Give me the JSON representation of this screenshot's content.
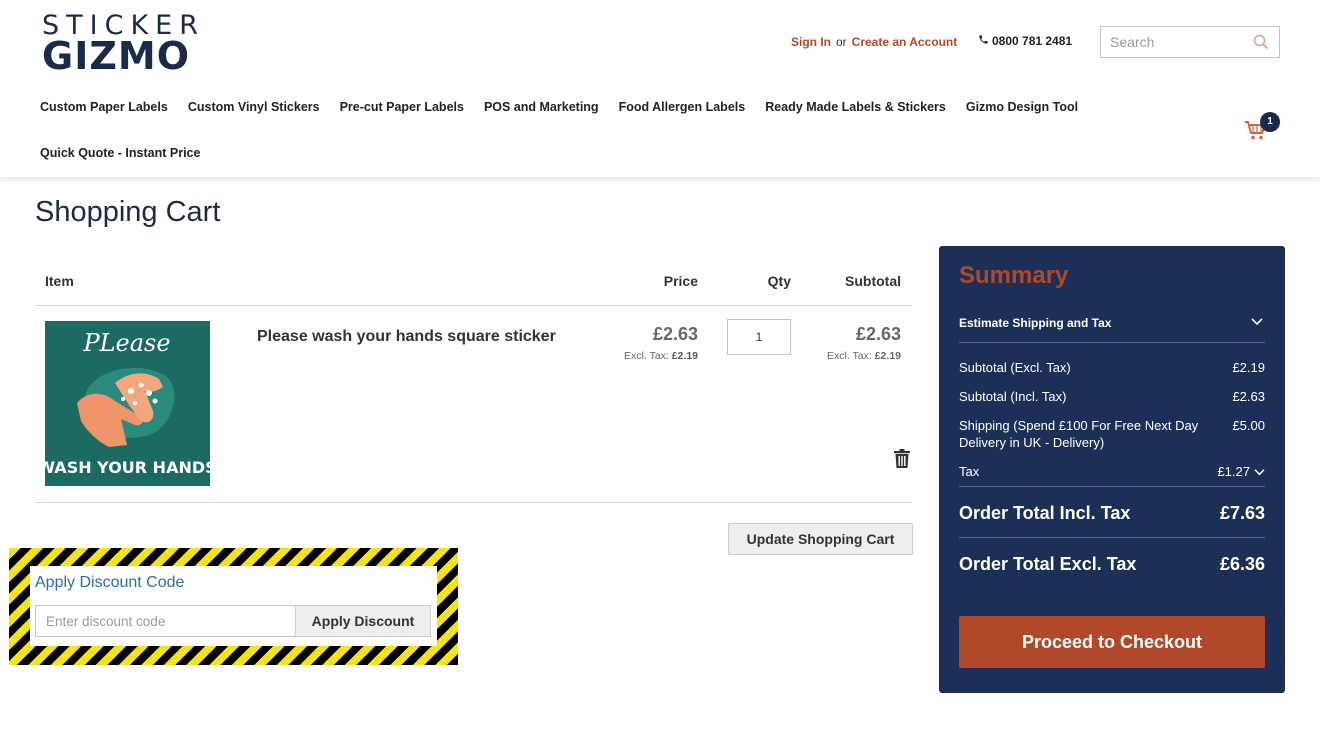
{
  "brand": {
    "top": "STICKER",
    "bottom": "GIZMO"
  },
  "header": {
    "sign_in": "Sign In",
    "or": "or",
    "create_account": "Create an Account",
    "phone": "0800 781 2481",
    "search_placeholder": "Search"
  },
  "nav": {
    "items": [
      "Custom Paper Labels",
      "Custom Vinyl Stickers",
      "Pre-cut Paper Labels",
      "POS and Marketing",
      "Food Allergen Labels",
      "Ready Made Labels & Stickers",
      "Gizmo Design Tool",
      "Quick Quote - Instant Price"
    ]
  },
  "cart_count": "1",
  "page_title": "Shopping Cart",
  "table": {
    "col_item": "Item",
    "col_price": "Price",
    "col_qty": "Qty",
    "col_subtotal": "Subtotal"
  },
  "item": {
    "name": "Please wash your hands square sticker",
    "image_text_top": "PLease",
    "image_text_bottom": "WASH YOUR HANDS",
    "price": "£2.63",
    "excl_label": "Excl. Tax:",
    "price_excl": "£2.19",
    "qty": "1",
    "subtotal": "£2.63",
    "subtotal_excl": "£2.19"
  },
  "update_cart": "Update Shopping Cart",
  "discount": {
    "title": "Apply Discount Code",
    "placeholder": "Enter discount code",
    "button": "Apply Discount"
  },
  "summary": {
    "title": "Summary",
    "estimate": "Estimate Shipping and Tax",
    "rows": [
      {
        "label": "Subtotal (Excl. Tax)",
        "value": "£2.19"
      },
      {
        "label": "Subtotal (Incl. Tax)",
        "value": "£2.63"
      },
      {
        "label": "Shipping (Spend £100 For Free Next Day Delivery in UK - Delivery)",
        "value": "£5.00"
      },
      {
        "label": "Tax",
        "value": "£1.27"
      }
    ],
    "total_incl_label": "Order Total Incl. Tax",
    "total_incl": "£7.63",
    "total_excl_label": "Order Total Excl. Tax",
    "total_excl": "£6.36",
    "checkout": "Proceed to Checkout"
  },
  "colors": {
    "navy": "#1c3057",
    "accent": "#b1482a",
    "link_blue": "#2d6ca8",
    "sticker_teal": "#1b6b62"
  },
  "icons": [
    "phone-icon",
    "search-icon",
    "cart-icon",
    "trash-icon",
    "chevron-down-icon"
  ]
}
